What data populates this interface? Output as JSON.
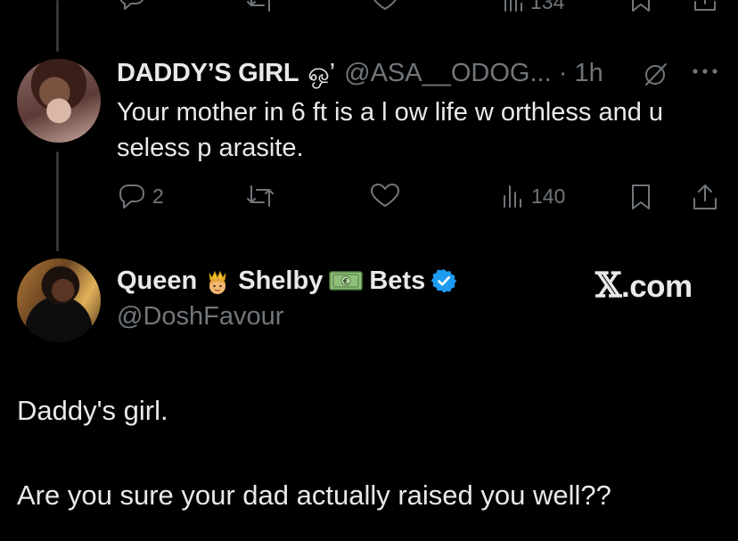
{
  "top_actions": {
    "views": "134"
  },
  "reply": {
    "display_name": "DADDY’S GIRL",
    "name_emoji": "ஒ’",
    "handle": "@ASA__ODOG...",
    "separator": "·",
    "time": "1h",
    "text": "Your mother in 6 ft is a l ow life w orthless and u seless p arasite.",
    "actions": {
      "replies": "2",
      "views": "140"
    }
  },
  "quoted": {
    "display_name_parts": [
      "Queen",
      "Shelby",
      "Bets"
    ],
    "handle": "@DoshFavour",
    "watermark_x": "𝕏",
    "watermark_domain": ".com",
    "line1": "Daddy's girl.",
    "line2": "Are you sure your dad actually raised you well??"
  },
  "colors": {
    "background": "#000000",
    "text": "#e7e9ea",
    "muted": "#71767b",
    "verified": "#1d9bf0",
    "thread_line": "#333639"
  },
  "icons": [
    "reply-icon",
    "retweet-icon",
    "like-icon",
    "views-icon",
    "bookmark-icon",
    "share-icon",
    "grok-icon",
    "more-icon",
    "verified-badge-icon",
    "princess-emoji-icon",
    "money-emoji-icon"
  ]
}
